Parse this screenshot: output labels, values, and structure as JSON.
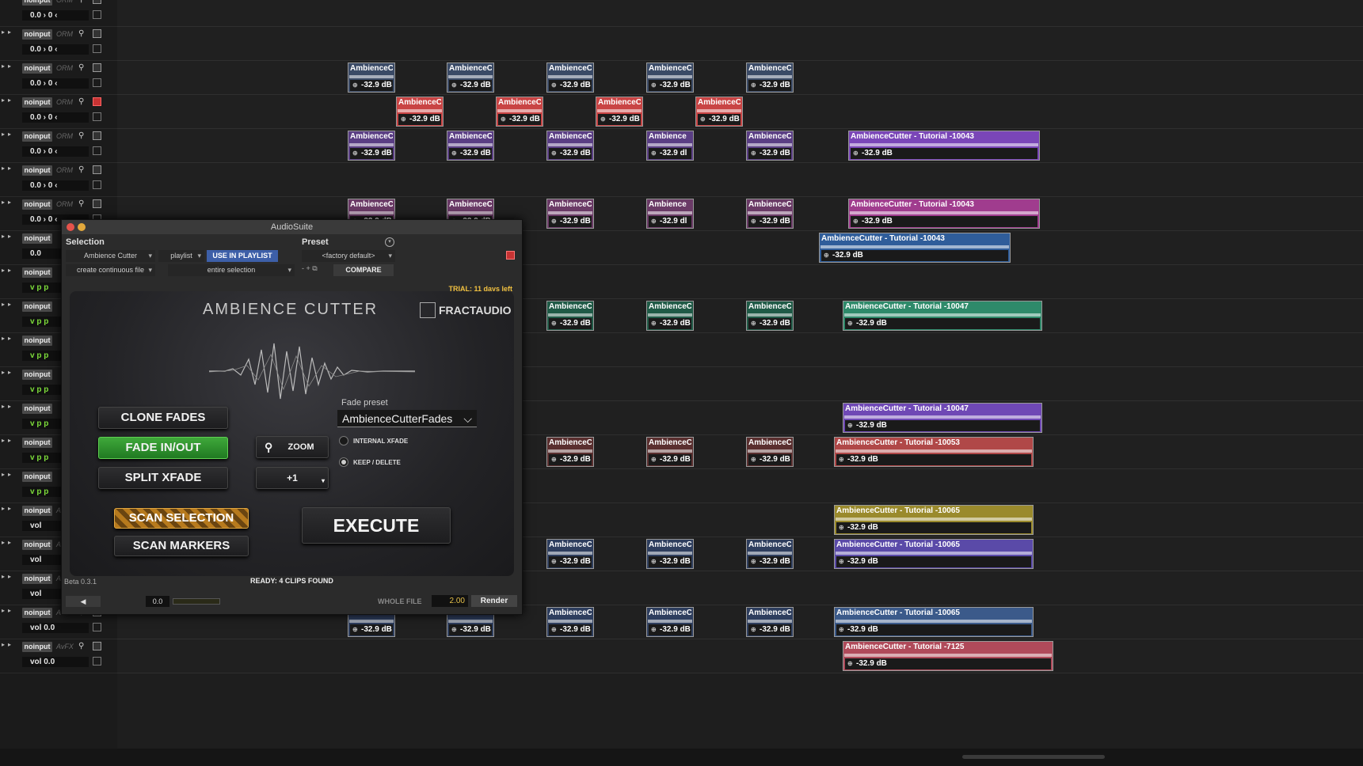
{
  "tracks": [
    {
      "input": "noinput",
      "insert": "ORM",
      "vals": "0.0 › 0 ‹",
      "red": false
    },
    {
      "input": "noinput",
      "insert": "ORM",
      "vals": "0.0 › 0 ‹",
      "red": false
    },
    {
      "input": "noinput",
      "insert": "ORM",
      "vals": "0.0 › 0 ‹",
      "red": false
    },
    {
      "input": "noinput",
      "insert": "ORM",
      "vals": "0.0 › 0 ‹",
      "red": true
    },
    {
      "input": "noinput",
      "insert": "ORM",
      "vals": "0.0 › 0 ‹",
      "red": false
    },
    {
      "input": "noinput",
      "insert": "ORM",
      "vals": "0.0 › 0 ‹",
      "red": false
    },
    {
      "input": "noinput",
      "insert": "ORM",
      "vals": "0.0 › 0 ‹",
      "red": false
    },
    {
      "input": "noinput",
      "insert": "",
      "vals": "0.0",
      "red": false
    },
    {
      "input": "noinput",
      "insert": "",
      "vals": "v p p",
      "red": false
    },
    {
      "input": "noinput",
      "insert": "",
      "vals": "v p p",
      "red": false
    },
    {
      "input": "noinput",
      "insert": "",
      "vals": "v p p",
      "red": false
    },
    {
      "input": "noinput",
      "insert": "",
      "vals": "v p p",
      "red": false
    },
    {
      "input": "noinput",
      "insert": "",
      "vals": "v p p",
      "red": false
    },
    {
      "input": "noinput",
      "insert": "",
      "vals": "v p p",
      "red": false
    },
    {
      "input": "noinput",
      "insert": "",
      "vals": "v p p",
      "red": false
    },
    {
      "input": "noinput",
      "insert": "A",
      "vals": "vol",
      "red": false
    },
    {
      "input": "noinput",
      "insert": "A",
      "vals": "vol",
      "red": false
    },
    {
      "input": "noinput",
      "insert": "A",
      "vals": "vol",
      "red": false
    },
    {
      "input": "noinput",
      "insert": "A",
      "vals": "vol 0.0",
      "red": false
    },
    {
      "input": "noinput",
      "insert": "AvFX",
      "vals": "vol 0.0",
      "red": false
    }
  ],
  "clip_short": "AmbienceC",
  "clip_mid": "Ambience",
  "clip_db": "-32.9 dB",
  "clip_db_cut": "-32.9 dl",
  "clips_long": [
    {
      "row": 4,
      "name": "AmbienceCutter - Tutorial -10043",
      "color": "#7a46b8"
    },
    {
      "row": 6,
      "name": "AmbienceCutter - Tutorial -10043",
      "color": "#a03c8e"
    },
    {
      "row": 7,
      "name": "AmbienceCutter - Tutorial -10043",
      "color": "#2f5d9a"
    },
    {
      "row": 9,
      "name": "AmbienceCutter - Tutorial -10047",
      "color": "#2e8a6a"
    },
    {
      "row": 12,
      "name": "AmbienceCutter - Tutorial -10047",
      "color": "#6f48b5"
    },
    {
      "row": 13,
      "name": "AmbienceCutter - Tutorial -10053",
      "color": "#b04848"
    },
    {
      "row": 15,
      "name": "AmbienceCutter - Tutorial -10065",
      "color": "#9a8a2c"
    },
    {
      "row": 16,
      "name": "AmbienceCutter - Tutorial -10065",
      "color": "#5a4aa8"
    },
    {
      "row": 18,
      "name": "AmbienceCutter - Tutorial -10065",
      "color": "#3b5a8a"
    },
    {
      "row": 19,
      "name": "AmbienceCutter - Tutorial -7125",
      "color": "#b04a5a"
    }
  ],
  "audiosuite": {
    "title": "AudioSuite",
    "selection_label": "Selection",
    "preset_label": "Preset",
    "plugin_select": "Ambience Cutter",
    "playlist_select": "playlist",
    "use_in_playlist": "USE IN PLAYLIST",
    "preset_select": "<factory default>",
    "continuous_select": "create continuous file",
    "entire_select": "entire selection",
    "compare": "COMPARE",
    "trial": "TRIAL: 11 days left",
    "plugin_name": "AMBIENCE CUTTER",
    "brand": "FRACTAUDIO",
    "clone_fades": "CLONE FADES",
    "fade_in_out": "FADE IN/OUT",
    "split_xfade": "SPLIT XFADE",
    "zoom": "ZOOM",
    "plus_one": "+1",
    "fade_preset_label": "Fade preset",
    "fade_preset_value": "AmbienceCutterFades",
    "internal_xfade": "INTERNAL XFADE",
    "keep_delete": "KEEP / DELETE",
    "scan_selection": "SCAN SELECTION",
    "scan_markers": "SCAN MARKERS",
    "execute": "EXECUTE",
    "beta": "Beta 0.3.1",
    "status": "READY: 4 CLIPS FOUND",
    "gain_value": "0.0",
    "whole_file": "WHOLE FILE",
    "handle_value": "2.00",
    "render": "Render"
  }
}
